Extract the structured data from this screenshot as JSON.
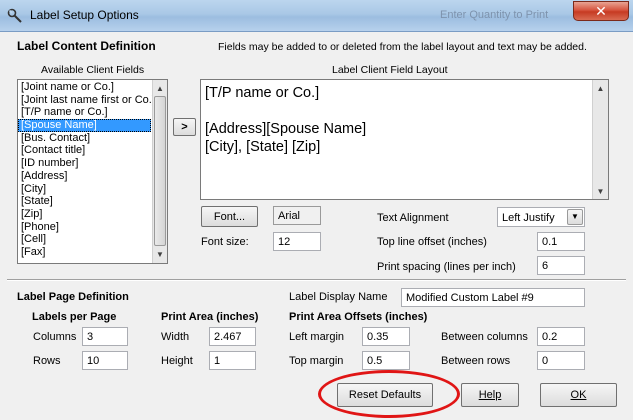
{
  "window": {
    "title": "Label Setup Options",
    "ghost_title": "Enter Quantity to Print",
    "close_glyph": "✕"
  },
  "content_definition": {
    "heading": "Label Content Definition",
    "note": "Fields may be added to or deleted from the label layout and text may be added.",
    "available_label": "Available Client Fields",
    "layout_label": "Label Client Field Layout",
    "available_fields": [
      "[Joint name or Co.]",
      "[Joint last name first or Co.]",
      "[T/P name or Co.]",
      "[Spouse Name]",
      "[Bus. Contact]",
      "[Contact title]",
      "[ID number]",
      "[Address]",
      "[City]",
      "[State]",
      "[Zip]",
      "[Phone]",
      "[Cell]",
      "[Fax]"
    ],
    "selected_field": "[Spouse Name]",
    "add_button": ">",
    "layout_lines": [
      "[T/P name or Co.]",
      "",
      "[Address][Spouse Name]",
      "[City], [State] [Zip]"
    ],
    "font_button": "Font...",
    "font_name": "Arial",
    "font_size_label": "Font size:",
    "font_size": "12",
    "text_alignment_label": "Text Alignment",
    "text_alignment": "Left Justify",
    "top_line_offset_label": "Top line offset (inches)",
    "top_line_offset": "0.1",
    "print_spacing_label": "Print spacing (lines per inch)",
    "print_spacing": "6"
  },
  "page_definition": {
    "heading": "Label Page Definition",
    "display_name_label": "Label Display Name",
    "display_name": "Modified Custom Label #9",
    "labels_per_page": {
      "heading": "Labels per Page",
      "columns_label": "Columns",
      "columns": "3",
      "rows_label": "Rows",
      "rows": "10"
    },
    "print_area": {
      "heading": "Print Area (inches)",
      "width_label": "Width",
      "width": "2.467",
      "height_label": "Height",
      "height": "1"
    },
    "offsets": {
      "heading": "Print Area Offsets (inches)",
      "left_margin_label": "Left margin",
      "left_margin": "0.35",
      "top_margin_label": "Top margin",
      "top_margin": "0.5",
      "between_columns_label": "Between columns",
      "between_columns": "0.2",
      "between_rows_label": "Between rows",
      "between_rows": "0"
    }
  },
  "buttons": {
    "reset": "Reset Defaults",
    "help": "Help",
    "ok": "OK"
  },
  "colors": {
    "selection": "#3399ff",
    "annotation_circle": "#e01515"
  }
}
